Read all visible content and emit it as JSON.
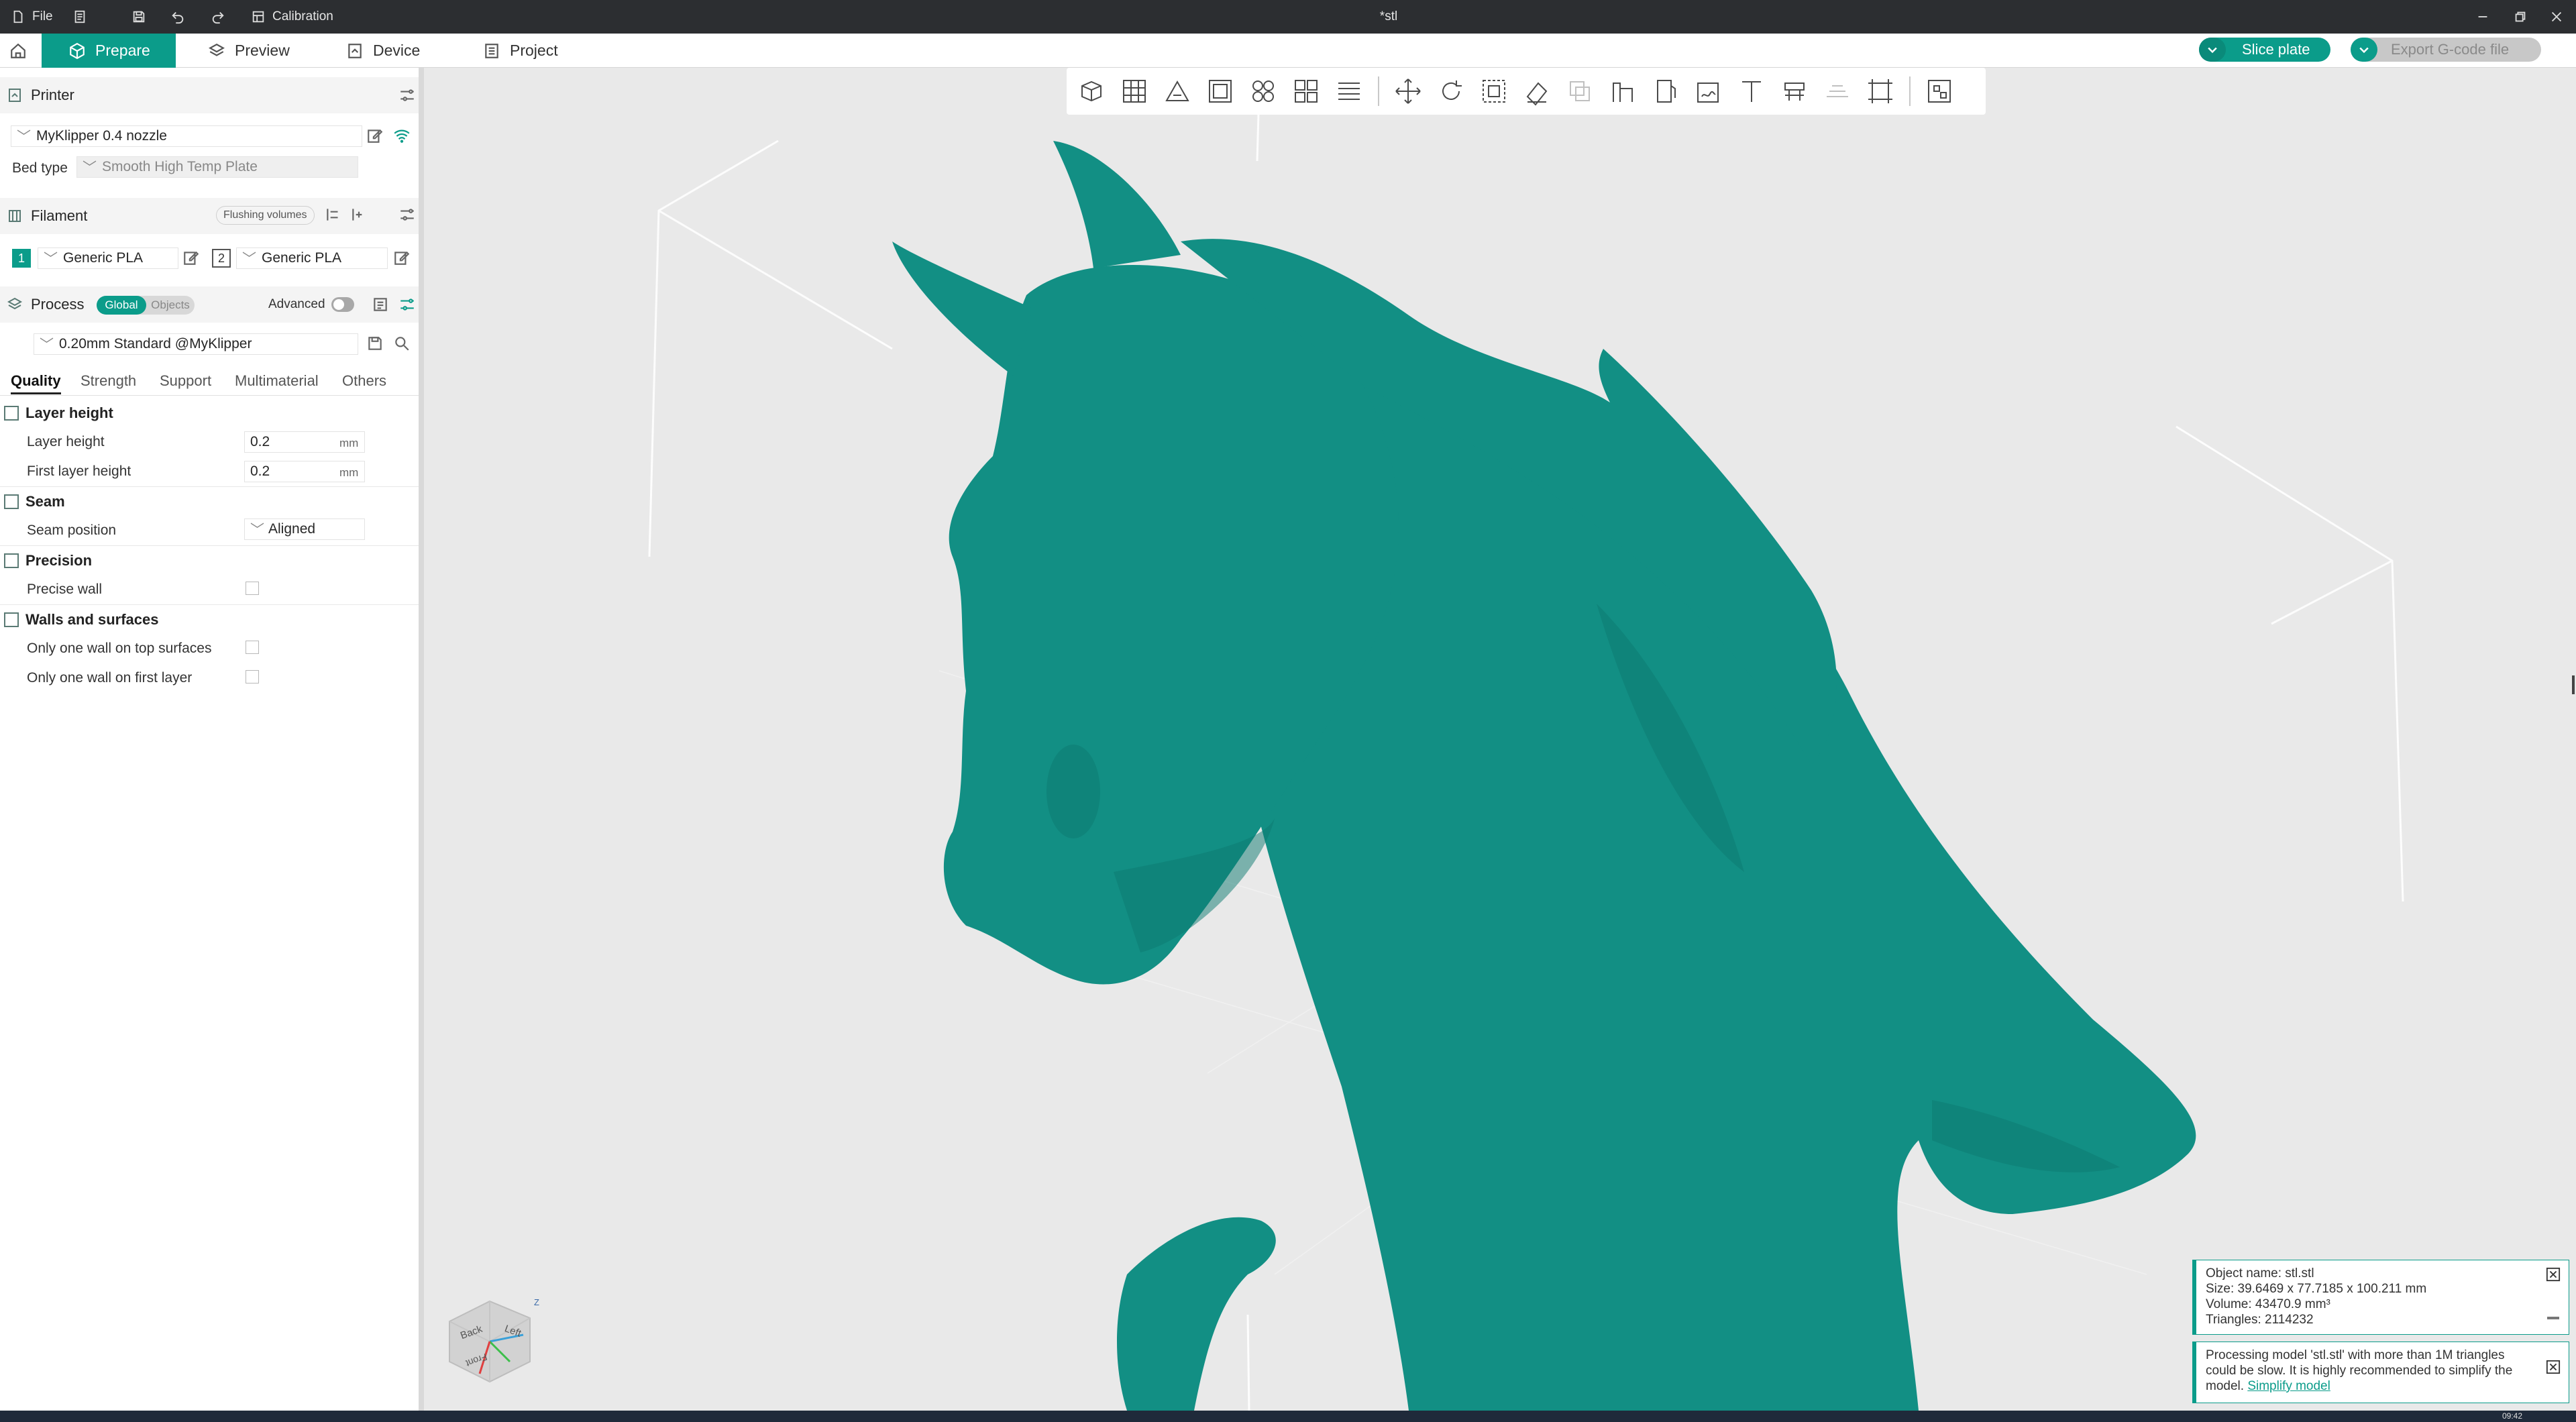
{
  "titlebar": {
    "file_label": "File",
    "calibration_label": "Calibration",
    "document_title": "*stl",
    "bg_color": "#2c2e31"
  },
  "tabs": {
    "prepare": "Prepare",
    "preview": "Preview",
    "device": "Device",
    "project": "Project",
    "accent": "#0b9c8a"
  },
  "actions": {
    "slice_plate": "Slice plate",
    "export_gcode": "Export G-code file"
  },
  "printer": {
    "section_title": "Printer",
    "selected_printer": "MyKlipper 0.4 nozzle",
    "bed_type_label": "Bed type",
    "bed_type_value": "Smooth High Temp Plate"
  },
  "filament": {
    "section_title": "Filament",
    "flushing_volumes": "Flushing volumes",
    "slots": [
      {
        "number": "1",
        "name": "Generic PLA"
      },
      {
        "number": "2",
        "name": "Generic PLA"
      }
    ]
  },
  "process": {
    "section_title": "Process",
    "toggle_global": "Global",
    "toggle_objects": "Objects",
    "advanced_label": "Advanced",
    "profile": "0.20mm Standard @MyKlipper",
    "tabs": [
      "Quality",
      "Strength",
      "Support",
      "Multimaterial",
      "Others"
    ]
  },
  "quality": {
    "layer_height_group": "Layer height",
    "layer_height_label": "Layer height",
    "layer_height_value": "0.2",
    "first_layer_height_label": "First layer height",
    "first_layer_height_value": "0.2",
    "unit": "mm",
    "seam_group": "Seam",
    "seam_position_label": "Seam position",
    "seam_position_value": "Aligned",
    "precision_group": "Precision",
    "precise_wall_label": "Precise wall",
    "walls_group": "Walls and surfaces",
    "one_wall_top_label": "Only one wall on top surfaces",
    "one_wall_first_label": "Only one wall on first layer"
  },
  "view_cube": {
    "back": "Back",
    "left": "Left",
    "front": "Front",
    "z": "Z"
  },
  "object_info": {
    "name": "Object name: stl.stl",
    "size": "Size: 39.6469 x 77.7185 x 100.211 mm",
    "volume": "Volume: 43470.9 mm³",
    "triangles": "Triangles: 2114232"
  },
  "warning": {
    "text": "Processing model 'stl.stl' with more than 1M triangles could be slow. It is highly recommended to simplify the model.",
    "link": "Simplify model"
  },
  "model_color": "#128f84",
  "taskbar": {
    "time": "09:42"
  }
}
